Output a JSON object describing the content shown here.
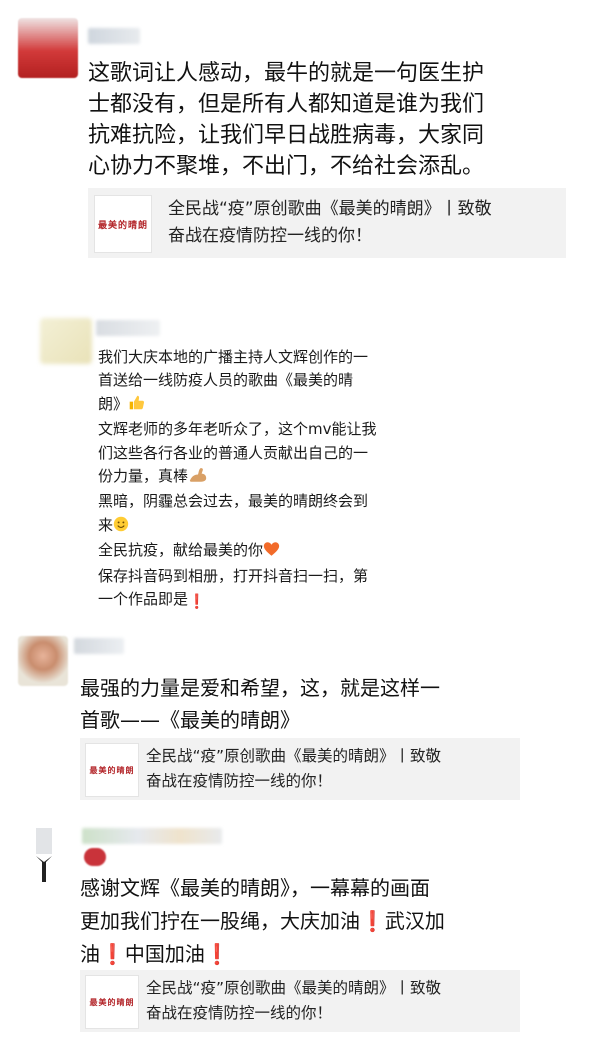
{
  "posts": [
    {
      "text_lines": [
        "这歌词让人感动，最牛的就是一句医生护",
        "士都没有，但是所有人都知道是谁为我们",
        "抗难抗险，让我们早日战胜病毒，大家同",
        "心协力不聚堆，不出门，不给社会添乱。"
      ],
      "share": {
        "thumb_text": "最美的晴朗",
        "title_lines": [
          "全民战“疫”原创歌曲《最美的晴朗》丨致敬",
          "奋战在疫情防控一线的你！"
        ]
      }
    },
    {
      "lines": [
        {
          "text": "我们大庆本地的广播主持人文辉创作的一"
        },
        {
          "text": "首送给一线防疫人员的歌曲《最美的晴"
        },
        {
          "text": "朗》",
          "emoji": "thumbs-up-icon"
        },
        {
          "text": "文辉老师的多年老听众了，这个mv能让我"
        },
        {
          "text": "们这些各行各业的普通人贡献出自己的一"
        },
        {
          "text": "份力量，真棒",
          "emoji": "flexed-arm-icon"
        },
        {
          "text": "黑暗，阴霾总会过去，最美的晴朗终会到"
        },
        {
          "text": "来",
          "emoji": "smile-icon"
        },
        {
          "text": "全民抗疫，献给最美的你",
          "emoji": "orange-heart-icon"
        },
        {
          "text": "保存抖音码到相册，打开抖音扫一扫，第"
        },
        {
          "text": "一个作品即是",
          "emoji": "exclamation-icon"
        }
      ]
    },
    {
      "text_lines": [
        "最强的力量是爱和希望，这，就是这样一",
        "首歌——《最美的晴朗》"
      ],
      "share": {
        "thumb_text": "最美的晴朗",
        "title_lines": [
          "全民战“疫”原创歌曲《最美的晴朗》丨致敬",
          "奋战在疫情防控一线的你！"
        ]
      }
    },
    {
      "text_segments": [
        [
          "感谢文辉《最美的晴朗》，一幕幕的画面"
        ],
        [
          "更加我们拧在一股绳，大庆加油",
          "❗",
          "武汉加"
        ],
        [
          "油",
          "❗",
          "中国加油",
          "❗"
        ]
      ],
      "share": {
        "thumb_text": "最美的晴朗",
        "title_lines": [
          "全民战“疫”原创歌曲《最美的晴朗》丨致敬",
          "奋战在疫情防控一线的你！"
        ]
      }
    }
  ],
  "colors": {
    "text": "#111111",
    "share_bg": "#f2f2f2",
    "thumb_red": "#b3262a",
    "exclaim_red": "#d42b2b"
  }
}
